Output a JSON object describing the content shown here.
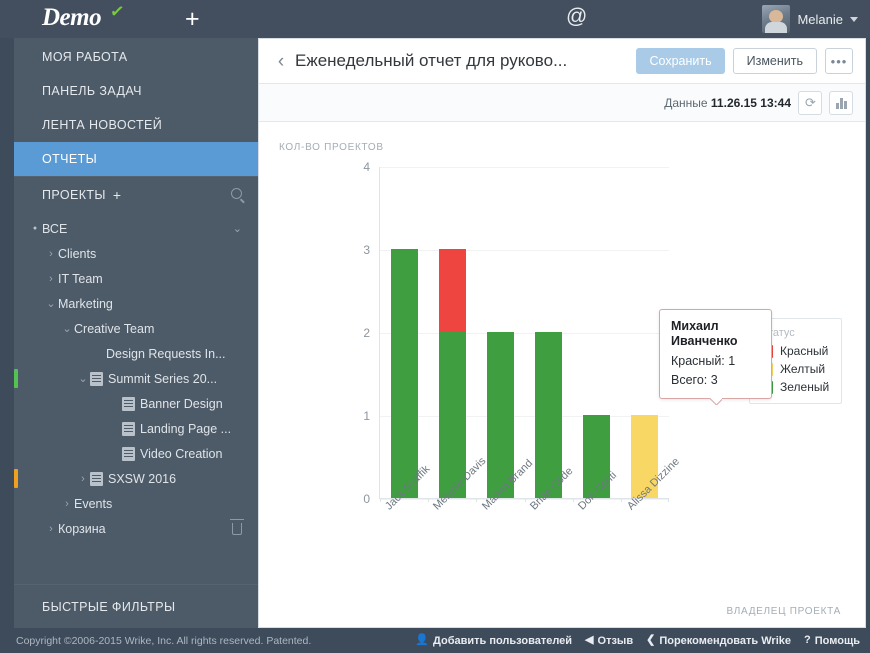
{
  "topbar": {
    "logo_text": "Demo",
    "new_label": "+",
    "mentions_icon": "at-icon",
    "inbox_icon": "inbox-icon",
    "user_name": "Melanie"
  },
  "sidebar": {
    "nav": [
      {
        "label": "МОЯ РАБОТА",
        "active": false
      },
      {
        "label": "ПАНЕЛЬ ЗАДАЧ",
        "active": false
      },
      {
        "label": "ЛЕНТА НОВОСТЕЙ",
        "active": false
      },
      {
        "label": "ОТЧЕТЫ",
        "active": true
      }
    ],
    "projects_header": "ПРОЕКТЫ",
    "projects_add": "+",
    "tree": [
      {
        "label": "ВСЕ",
        "indent": 0,
        "kind": "dot",
        "chevron": "down",
        "marker": ""
      },
      {
        "label": "Clients",
        "indent": 1,
        "kind": "arrow-right",
        "chevron": "",
        "marker": ""
      },
      {
        "label": "IT Team",
        "indent": 1,
        "kind": "arrow-right",
        "chevron": "",
        "marker": ""
      },
      {
        "label": "Marketing",
        "indent": 1,
        "kind": "arrow-down",
        "chevron": "",
        "marker": ""
      },
      {
        "label": "Creative Team",
        "indent": 2,
        "kind": "arrow-down",
        "chevron": "",
        "marker": ""
      },
      {
        "label": "Design Requests In...",
        "indent": 4,
        "kind": "none",
        "chevron": "",
        "marker": ""
      },
      {
        "label": "Summit Series 20...",
        "indent": 3,
        "kind": "arrow-down-doc",
        "chevron": "",
        "marker": "#55c155"
      },
      {
        "label": "Banner Design",
        "indent": 5,
        "kind": "doc",
        "chevron": "",
        "marker": ""
      },
      {
        "label": "Landing Page ...",
        "indent": 5,
        "kind": "doc",
        "chevron": "",
        "marker": ""
      },
      {
        "label": "Video Creation",
        "indent": 5,
        "kind": "doc",
        "chevron": "",
        "marker": ""
      },
      {
        "label": "SXSW 2016",
        "indent": 3,
        "kind": "arrow-right-doc",
        "chevron": "",
        "marker": "#f0a020"
      },
      {
        "label": "Events",
        "indent": 2,
        "kind": "arrow-right",
        "chevron": "",
        "marker": ""
      },
      {
        "label": "Корзина",
        "indent": 1,
        "kind": "arrow-right",
        "chevron": "trash",
        "marker": ""
      }
    ],
    "quick_filters": "БЫСТРЫЕ ФИЛЬТРЫ"
  },
  "report": {
    "title": "Еженедельный отчет для руково...",
    "save_label": "Сохранить",
    "edit_label": "Изменить",
    "more_label": "•••",
    "data_label": "Данные",
    "data_timestamp": "11.26.15 13:44"
  },
  "tooltip": {
    "name_line1": "Михаил",
    "name_line2": "Иванченко",
    "row1": "Красный: 1",
    "row2": "Всего: 3"
  },
  "legend": {
    "title": "Статус",
    "items": [
      {
        "label": "Красный",
        "color": "#ef4540"
      },
      {
        "label": "Желтый",
        "color": "#f8d765"
      },
      {
        "label": "Зеленый",
        "color": "#3e9e40"
      }
    ]
  },
  "chart_data": {
    "type": "bar",
    "title": "",
    "xlabel": "ВЛАДЕЛЕЦ ПРОЕКТА",
    "ylabel": "КОЛ-ВО ПРОЕКТОВ",
    "ylim": [
      0,
      4
    ],
    "yticks": [
      0,
      1,
      2,
      3,
      4
    ],
    "grid": true,
    "stacked": true,
    "legend_position": "right",
    "categories": [
      "Jack Graffik",
      "Melanie Davis",
      "Marian Brand",
      "Brian Code",
      "Don Conti",
      "Alissa Dizzine"
    ],
    "series": [
      {
        "name": "Зеленый",
        "color": "#3e9e40",
        "values": [
          3,
          2,
          2,
          2,
          1,
          0
        ]
      },
      {
        "name": "Красный",
        "color": "#ef4540",
        "values": [
          0,
          1,
          0,
          0,
          0,
          0
        ]
      },
      {
        "name": "Желтый",
        "color": "#f8d765",
        "values": [
          0,
          0,
          0,
          0,
          0,
          1
        ]
      }
    ],
    "totals": [
      3,
      3,
      2,
      2,
      1,
      1
    ]
  },
  "footer": {
    "copyright": "Copyright ©2006-2015 Wrike, Inc. All rights reserved. Patented.",
    "links": [
      {
        "label": "Добавить пользователей",
        "icon": "add-user-icon",
        "glyph": "👤"
      },
      {
        "label": "Отзыв",
        "icon": "megaphone-icon",
        "glyph": "◀"
      },
      {
        "label": "Порекомендовать Wrike",
        "icon": "share-icon",
        "glyph": "❮"
      },
      {
        "label": "Помощь",
        "icon": "help-icon",
        "glyph": "?"
      }
    ]
  }
}
